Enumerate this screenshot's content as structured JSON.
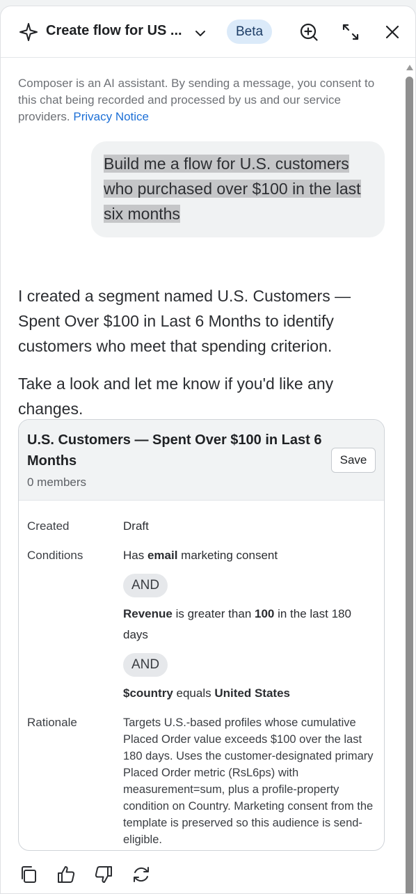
{
  "header": {
    "title": "Create flow for US ...",
    "badge": "Beta",
    "icons": [
      "sparkle-icon",
      "chevron-down-icon",
      "zoom-in-icon",
      "expand-icon",
      "close-icon"
    ]
  },
  "consent": {
    "text": "Composer is an AI assistant. By sending a message, you consent to this chat being recorded and processed by us and our service providers. ",
    "link": "Privacy Notice"
  },
  "user_message": "Build me a flow for U.S. customers who purchased over $100 in the last six months",
  "assistant": {
    "paragraph1": "I created a segment named U.S. Customers — Spent Over $100 in Last 6 Months to identify customers who meet that spending criterion.",
    "paragraph2": "Take a look and let me know if you'd like any changes."
  },
  "segment_card": {
    "title": "U.S. Customers — Spent Over $100 in Last 6 Months",
    "members": "0 members",
    "save_label": "Save",
    "created_label": "Created",
    "created_value": "Draft",
    "conditions_label": "Conditions",
    "condition1": {
      "pre": "Has ",
      "bold": "email",
      "post": " marketing consent"
    },
    "and_label": "AND",
    "condition2": {
      "bold1": "Revenue",
      "mid": " is greater than ",
      "bold2": "100",
      "post": " in the last 180 days"
    },
    "condition3": {
      "bold1": "$country",
      "mid": " equals ",
      "bold2": "United States"
    },
    "rationale_label": "Rationale",
    "rationale_value": "Targets U.S.-based profiles whose cumulative Placed Order value exceeds $100 over the last 180 days. Uses the customer-designated primary Placed Order metric (RsL6ps) with measurement=sum, plus a profile-property condition on Country. Marketing consent from the template is preserved so this audience is send-eligible."
  },
  "actions": [
    "copy-icon",
    "thumbs-up-icon",
    "thumbs-down-icon",
    "regenerate-icon"
  ],
  "colors": {
    "accent_link": "#1c6fd6",
    "beta_bg": "#dbeaf9",
    "bubble_bg": "#f0f2f3",
    "highlight": "#c5c6c8",
    "card_header_bg": "#f1f3f4"
  }
}
